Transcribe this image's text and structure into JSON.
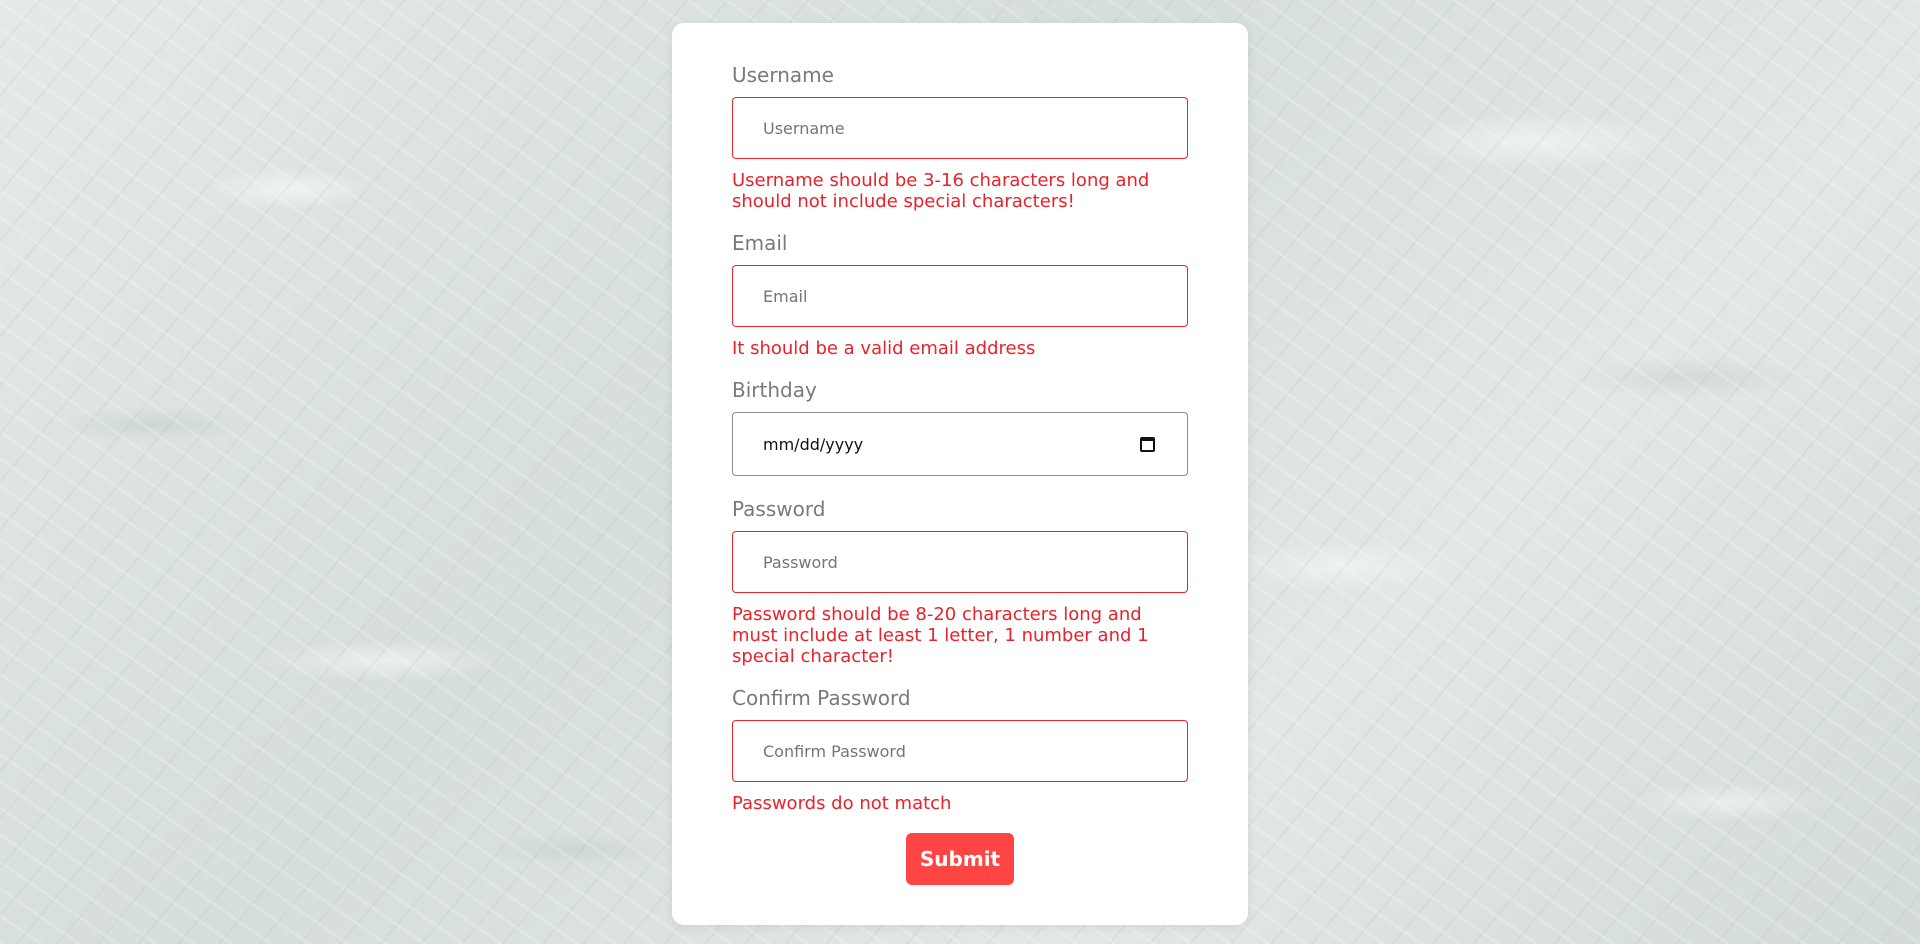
{
  "form": {
    "username": {
      "label": "Username",
      "placeholder": "Username",
      "error": "Username should be 3-16 characters long and should not include special characters!"
    },
    "email": {
      "label": "Email",
      "placeholder": "Email",
      "error": "It should be a valid email address"
    },
    "birthday": {
      "label": "Birthday",
      "placeholder": "mm/dd/yyyy"
    },
    "password": {
      "label": "Password",
      "placeholder": "Password",
      "error": "Password should be 8-20 characters long and must include at least 1 letter, 1 number and 1 special character!"
    },
    "confirm_password": {
      "label": "Confirm Password",
      "placeholder": "Confirm Password",
      "error": "Passwords do not match"
    },
    "submit_label": "Submit"
  },
  "colors": {
    "error": "#e8222a",
    "submit": "#ff4544",
    "label": "#7a7a7a"
  }
}
